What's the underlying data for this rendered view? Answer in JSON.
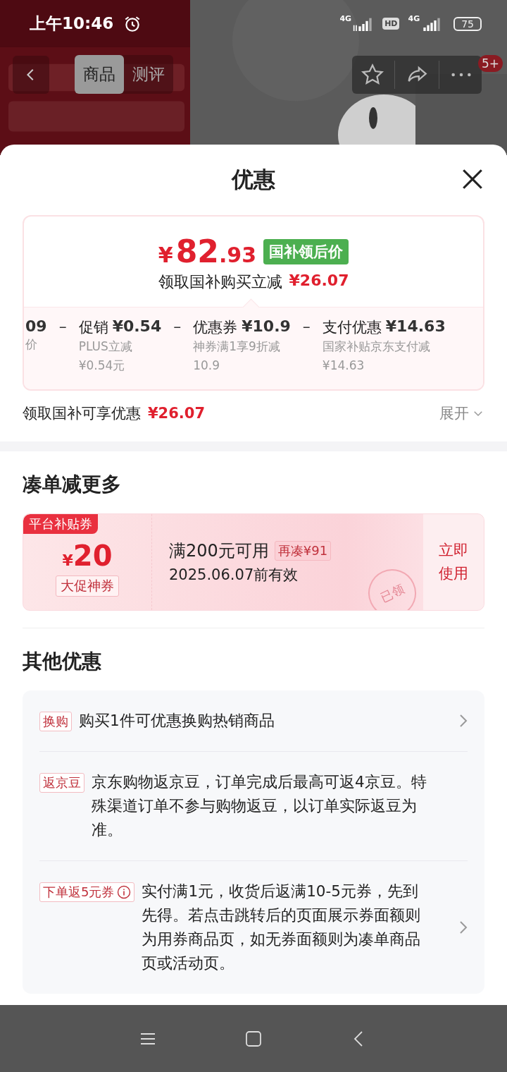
{
  "status_bar": {
    "time": "上午10:46",
    "network_1": "4G",
    "hd": "HD",
    "network_2": "4G",
    "battery": "75"
  },
  "top_nav": {
    "tabs": [
      {
        "label": "商品",
        "selected": true
      },
      {
        "label": "测评",
        "selected": false
      }
    ],
    "badge": "5+"
  },
  "sheet": {
    "title": "优惠"
  },
  "price_card": {
    "currency": "¥",
    "integer": "82",
    "decimal": ".93",
    "tag": "国补领后价",
    "subtitle": "领取国补购买立减",
    "saving": "¥26.07",
    "breakdown": [
      {
        "kind": "partial",
        "amount": "09",
        "desc": "价"
      },
      {
        "kind": "full",
        "operator": "–",
        "label": "促销",
        "amount": "¥0.54",
        "desc": "PLUS立减",
        "sub": "¥0.54元"
      },
      {
        "kind": "full",
        "operator": "–",
        "label": "优惠券",
        "amount": "¥10.9",
        "desc": "神券满1享9折减",
        "sub": "10.9"
      },
      {
        "kind": "full",
        "operator": "–",
        "label": "支付优惠",
        "amount": "¥14.63",
        "desc": "国家补贴京东支付减",
        "sub": "¥14.63"
      }
    ]
  },
  "summary": {
    "label": "领取国补可享优惠",
    "amount": "¥26.07",
    "expand": "展开"
  },
  "combo_section": {
    "title": "凑单减更多",
    "coupon": {
      "ribbon": "平台补贴券",
      "currency": "¥",
      "amount": "20",
      "tag": "大促神券",
      "condition": "满200元可用",
      "remaining": "再凑¥91",
      "validity": "2025.06.07前有效",
      "action": "立即使用",
      "stamp": "已领"
    }
  },
  "other_section": {
    "title": "其他优惠",
    "offers": [
      {
        "tag": "换购",
        "info": false,
        "text": "购买1件可优惠换购热销商品",
        "arrow": true
      },
      {
        "tag": "返京豆",
        "info": false,
        "text": "京东购物返京豆，订单完成后最高可返4京豆。特殊渠道订单不参与购物返豆，以订单实际返豆为准。",
        "arrow": false
      },
      {
        "tag": "下单返5元券",
        "info": true,
        "text": "实付满1元，收货后返满10-5元券，先到先得。若点击跳转后的页面展示券面额则为用券商品页，如无券面额则为凑单商品页或活动页。",
        "arrow": true
      }
    ]
  }
}
